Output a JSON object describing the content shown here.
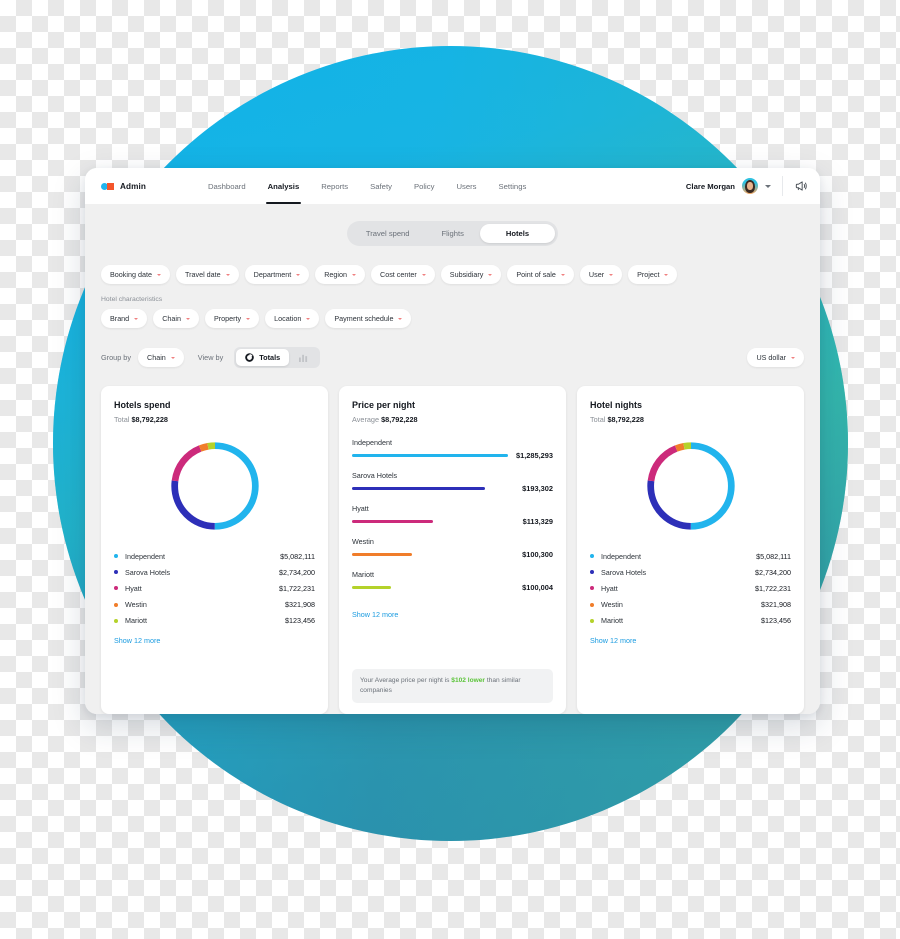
{
  "brand": {
    "name": "Admin",
    "dot_color": "#21b4ed",
    "square_color": "#f4552b"
  },
  "nav": {
    "links": [
      {
        "label": "Dashboard",
        "active": false
      },
      {
        "label": "Analysis",
        "active": true
      },
      {
        "label": "Reports",
        "active": false
      },
      {
        "label": "Safety",
        "active": false
      },
      {
        "label": "Policy",
        "active": false
      },
      {
        "label": "Users",
        "active": false
      },
      {
        "label": "Settings",
        "active": false
      }
    ],
    "user": "Clare Morgan",
    "user_menu_icon": "chevron-down-icon",
    "announcement_icon": "megaphone-icon"
  },
  "segmented": {
    "options": [
      {
        "label": "Travel spend",
        "active": false
      },
      {
        "label": "Flights",
        "active": false
      },
      {
        "label": "Hotels",
        "active": true
      }
    ]
  },
  "filters": {
    "primary": [
      "Booking date",
      "Travel date",
      "Department",
      "Region",
      "Cost center",
      "Subsidiary",
      "Point of sale",
      "User",
      "Project"
    ],
    "hotel_characteristics_label": "Hotel characteristics",
    "hotel_characteristics": [
      "Brand",
      "Chain",
      "Property",
      "Location",
      "Payment schedule"
    ]
  },
  "controls": {
    "group_by_label": "Group by",
    "group_by_value": "Chain",
    "view_by_label": "View by",
    "view_by_value": "Totals",
    "view_by_chart_icon": "bar-chart-icon",
    "currency": "US dollar"
  },
  "cards": {
    "hotels_spend": {
      "title": "Hotels spend",
      "sub_label": "Total",
      "sub_value": "$8,792,228",
      "show_more": "Show 12 more"
    },
    "price_per_night": {
      "title": "Price per night",
      "sub_label": "Average",
      "sub_value": "$8,792,228",
      "show_more": "Show 12 more",
      "insight_prefix": "Your Average price per night is ",
      "insight_highlight": "$102 lower",
      "insight_suffix": " than similar companies"
    },
    "hotel_nights": {
      "title": "Hotel nights",
      "sub_label": "Total",
      "sub_value": "$8,792,228",
      "show_more": "Show 12 more"
    }
  },
  "chart_data": [
    {
      "type": "pie",
      "title": "Hotels spend",
      "subtitle": "Total $8,792,228",
      "legend_position": "bottom",
      "labels": [
        "Independent",
        "Sarova Hotels",
        "Hyatt",
        "Westin",
        "Mariott"
      ],
      "values": [
        5082111,
        2734200,
        1722231,
        321908,
        123456
      ],
      "value_labels": [
        "$5,082,111",
        "$2,734,200",
        "$1,722,231",
        "$321,908",
        "$123,456"
      ],
      "colors": [
        "#21b4ed",
        "#2d2fb8",
        "#cc2a7b",
        "#f07d2a",
        "#b4d22a"
      ]
    },
    {
      "type": "bar",
      "title": "Price per night",
      "subtitle": "Average $8,792,228",
      "orientation": "horizontal",
      "categories": [
        "Independent",
        "Sarova Hotels",
        "Hyatt",
        "Westin",
        "Mariott"
      ],
      "values": [
        1285293,
        193302,
        113329,
        100300,
        100004
      ],
      "value_labels": [
        "$1,285,293",
        "$193,302",
        "$113,329",
        "$100,300",
        "$100,004"
      ],
      "bar_lengths_pct": [
        100,
        82,
        50,
        37,
        24
      ],
      "colors": [
        "#21b4ed",
        "#2d2fb8",
        "#cc2a7b",
        "#f07d2a",
        "#b4d22a"
      ]
    },
    {
      "type": "pie",
      "title": "Hotel nights",
      "subtitle": "Total $8,792,228",
      "legend_position": "bottom",
      "labels": [
        "Independent",
        "Sarova Hotels",
        "Hyatt",
        "Westin",
        "Mariott"
      ],
      "values": [
        5082111,
        2734200,
        1722231,
        321908,
        123456
      ],
      "value_labels": [
        "$5,082,111",
        "$2,734,200",
        "$1,722,231",
        "$321,908",
        "$123,456"
      ],
      "colors": [
        "#21b4ed",
        "#2d2fb8",
        "#cc2a7b",
        "#f07d2a",
        "#b4d22a"
      ]
    }
  ]
}
